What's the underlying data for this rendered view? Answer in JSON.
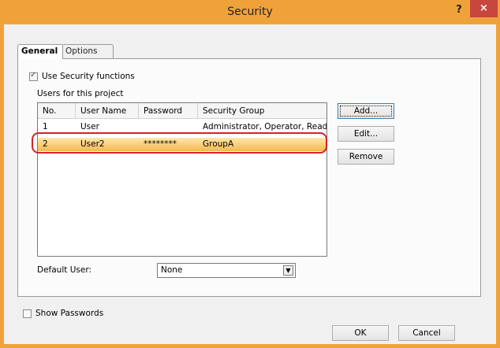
{
  "window": {
    "title": "Security",
    "help_label": "?",
    "close_label": "×"
  },
  "tabs": {
    "general": "General",
    "options": "Options"
  },
  "use_security": {
    "label": "Use Security functions",
    "checked": true
  },
  "users_label": "Users for this project",
  "table": {
    "headers": [
      "No.",
      "User Name",
      "Password",
      "Security Group"
    ],
    "rows": [
      {
        "no": "1",
        "user": "User",
        "password": "",
        "group": "Administrator, Operator, Reader"
      },
      {
        "no": "2",
        "user": "User2",
        "password": "********",
        "group": "GroupA"
      }
    ]
  },
  "buttons": {
    "add": "Add...",
    "edit": "Edit...",
    "remove": "Remove",
    "ok": "OK",
    "cancel": "Cancel"
  },
  "default_user": {
    "label": "Default User:",
    "value": "None"
  },
  "show_passwords": {
    "label": "Show Passwords",
    "checked": false
  },
  "colors": {
    "titlebar": "#f0a23a",
    "close": "#c7463d",
    "selection": "#f7b94a",
    "highlight_outline": "#d2232a"
  }
}
